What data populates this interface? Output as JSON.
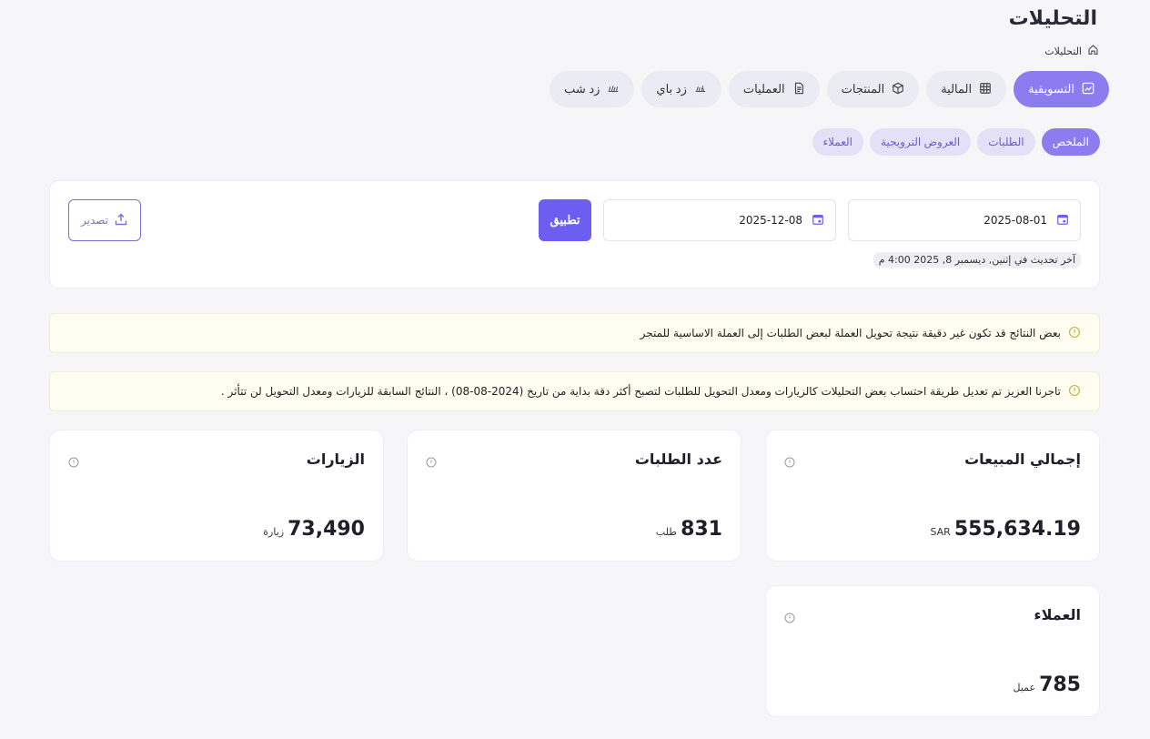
{
  "page": {
    "title": "التحليلات",
    "breadcrumb": "التحليلات"
  },
  "tabs": [
    {
      "label": "التسويقية",
      "icon": "chart-line-icon",
      "active": true
    },
    {
      "label": "المالية",
      "icon": "table-grid-icon",
      "active": false
    },
    {
      "label": "المنتجات",
      "icon": "box-icon",
      "active": false
    },
    {
      "label": "العمليات",
      "icon": "document-icon",
      "active": false
    },
    {
      "label": "زد باي",
      "icon": "zid-pay-icon",
      "active": false
    },
    {
      "label": "زد شب",
      "icon": "zid-ship-icon",
      "active": false
    }
  ],
  "subtabs": [
    {
      "label": "الملخص",
      "active": true
    },
    {
      "label": "الطلبات",
      "active": false
    },
    {
      "label": "العروض الترويجية",
      "active": false
    },
    {
      "label": "العملاء",
      "active": false
    }
  ],
  "filters": {
    "date_from": "2025-08-01",
    "date_to": "2025-12-08",
    "apply_label": "تطبيق",
    "export_label": "تصدير",
    "last_updated": "آخر تحديث في إثنين, ديسمبر 8, 2025 4:00 م"
  },
  "notices": [
    "بعض النتائج قد تكون غير دقيقة نتيجة تحويل العملة لبعض الطلبات إلى العملة الاساسية للمتجر",
    "تاجرنا العزيز تم تعديل طريقة احتساب بعض التحليلات كالزيارات ومعدل التحويل للطلبات لتصبح أكثر دقة بداية من تاريخ (2024-08-08) ، النتائج السابقة للزيارات ومعدل التحويل لن تتأثر ."
  ],
  "stats": {
    "sales": {
      "title": "إجمالي المبيعات",
      "value": "555,634.19",
      "unit": "SAR"
    },
    "orders": {
      "title": "عدد الطلبات",
      "value": "831",
      "unit": "طلب"
    },
    "visits": {
      "title": "الزيارات",
      "value": "73,490",
      "unit": "زيارة"
    },
    "customers": {
      "title": "العملاء",
      "value": "785",
      "unit": "عميل"
    }
  },
  "colors": {
    "accent": "#8b7cf0",
    "primary_button": "#6b5ef0",
    "notice_icon": "#c9b23a"
  }
}
